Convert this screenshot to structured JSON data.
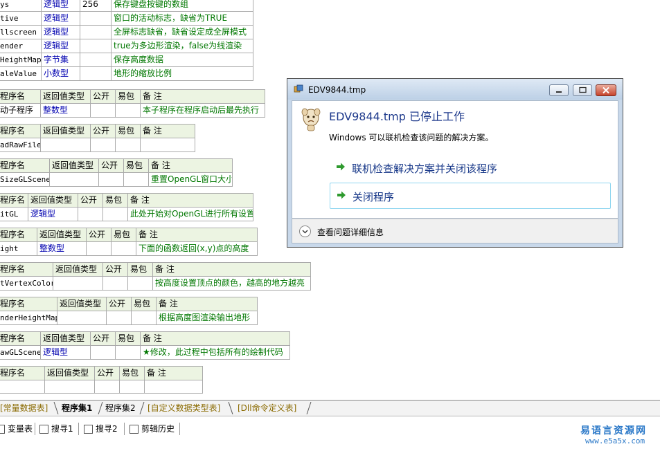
{
  "top_table": {
    "rows": [
      {
        "name": "ys",
        "type": "逻辑型",
        "size": "256",
        "note": "保存键盘按键的数组"
      },
      {
        "name": "tive",
        "type": "逻辑型",
        "size": "",
        "note": "窗口的活动标志，缺省为TRUE"
      },
      {
        "name": "llscreen",
        "type": "逻辑型",
        "size": "",
        "note": "全屏标志缺省，缺省设定成全屏模式"
      },
      {
        "name": "ender",
        "type": "逻辑型",
        "size": "",
        "note": "true为多边形渲染，false为线渲染"
      },
      {
        "name": "HeightMap",
        "type": "字节集",
        "size": "",
        "note": "保存高度数据"
      },
      {
        "name": "aleValue",
        "type": "小数型",
        "size": "",
        "note": "地形的缩放比例"
      }
    ]
  },
  "header_labels": {
    "name": "程序名",
    "ret": "返回值类型",
    "public": "公开",
    "easy": "易包",
    "note": "备 注"
  },
  "subs": [
    {
      "name": "动子程序",
      "ret": "整数型",
      "note": "本子程序在程序启动后最先执行"
    },
    {
      "name": "adRawFile",
      "ret": "",
      "note": ""
    },
    {
      "name": "SizeGLScene",
      "ret": "",
      "note": "重置OpenGL窗口大小"
    },
    {
      "name": "itGL",
      "ret": "逻辑型",
      "note": "此处开始对OpenGL进行所有设置"
    },
    {
      "name": "ight",
      "ret": "整数型",
      "note": "下面的函数返回(x,y)点的高度"
    },
    {
      "name": "tVertexColor",
      "ret": "",
      "note": "按高度设置顶点的颜色，越高的地方越亮"
    },
    {
      "name": "nderHeightMap",
      "ret": "",
      "note": "根据高度图渲染输出地形"
    },
    {
      "name": "awGLScene",
      "ret": "逻辑型",
      "note": "★修改，此过程中包括所有的绘制代码"
    },
    {
      "name": "",
      "ret": "",
      "note": ""
    }
  ],
  "tabs": [
    "[常量数据表]",
    "程序集1",
    "程序集2",
    "[自定义数据类型表]",
    "[Dll命令定义表]"
  ],
  "toolbar": [
    "变量表",
    "搜寻1",
    "搜寻2",
    "剪辑历史"
  ],
  "watermark": {
    "line1": "易语言资源网",
    "line2": "www.e5a5x.com"
  },
  "dialog": {
    "title": "EDV9844.tmp",
    "heading": "EDV9844.tmp 已停止工作",
    "subtext": "Windows 可以联机检查该问题的解决方案。",
    "option1": "联机检查解决方案并关闭该程序",
    "option2": "关闭程序",
    "details": "查看问题详细信息"
  },
  "colors": {
    "keyword_blue": "#0000b0",
    "comment_green": "#007700",
    "header_bg": "#ecf4e2",
    "dialog_heading": "#1e3a8c"
  }
}
